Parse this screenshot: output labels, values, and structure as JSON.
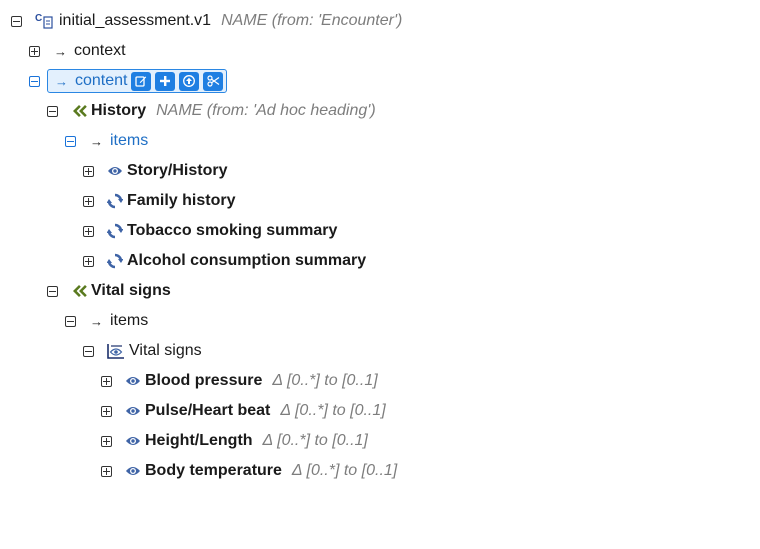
{
  "root": {
    "label": "initial_assessment.v1",
    "hint": "NAME (from: 'Encounter')",
    "icon": "composition-icon"
  },
  "context": {
    "label": "context"
  },
  "content": {
    "label": "content",
    "toolbar": [
      "edit-icon",
      "plus-icon",
      "upload-icon",
      "scissors-icon"
    ]
  },
  "history": {
    "label": "History",
    "hint": "NAME (from: 'Ad hoc heading')",
    "items_label": "items",
    "items": [
      {
        "label": "Story/History",
        "icon": "eye-icon"
      },
      {
        "label": "Family history",
        "icon": "cluster-icon"
      },
      {
        "label": "Tobacco smoking summary",
        "icon": "cluster-icon"
      },
      {
        "label": "Alcohol consumption summary",
        "icon": "cluster-icon"
      }
    ]
  },
  "vital_signs": {
    "label": "Vital signs",
    "items_label": "items",
    "group_label": "Vital signs",
    "items": [
      {
        "label": "Blood pressure",
        "hint": "Δ [0..*] to [0..1]"
      },
      {
        "label": "Pulse/Heart beat",
        "hint": "Δ [0..*] to [0..1]"
      },
      {
        "label": "Height/Length",
        "hint": "Δ [0..*] to [0..1]"
      },
      {
        "label": "Body temperature",
        "hint": "Δ [0..*] to [0..1]"
      }
    ]
  },
  "colors": {
    "accent": "#1f7fe2",
    "selection_bg": "#e3f0fd",
    "hint": "#7d7d7d",
    "section_icon": "#5a7a1f"
  }
}
